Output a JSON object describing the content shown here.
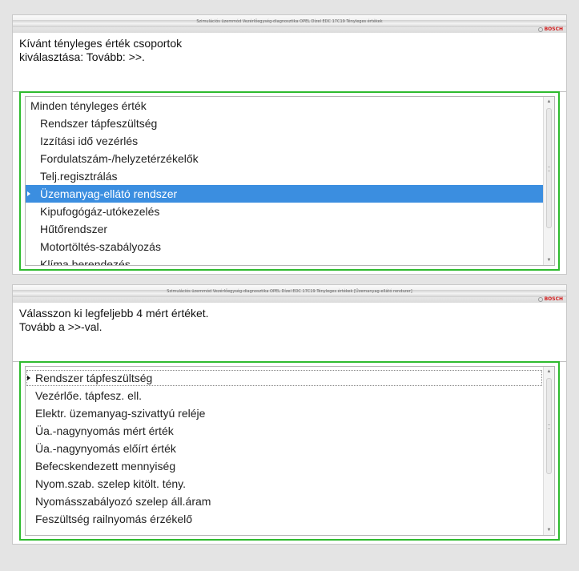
{
  "window1": {
    "title": "Szimulációs üzemmód Vezérlőegység-diagnosztika OPEL Dízel EDC 17C19 Tényleges értékek",
    "brand": "BOSCH",
    "prompt_line1": "Kívánt tényleges érték csoportok",
    "prompt_line2": "kiválasztása: Tovább: >>.",
    "items": [
      "Minden tényleges érték",
      "Rendszer tápfeszültség",
      "Izzítási idő vezérlés",
      "Fordulatszám-/helyzetérzékelők",
      "Telj.regisztrálás",
      "Üzemanyag-ellátó rendszer",
      "Kipufogógáz-utókezelés",
      "Hűtőrendszer",
      "Motortöltés-szabályozás",
      "Klíma berendezés"
    ],
    "selected_index": 5,
    "accent_color": "#3b8ee0",
    "frame_color": "#2fbb2f"
  },
  "window2": {
    "title": "Szimulációs üzemmód Vezérlőegység-diagnosztika OPEL Dízel EDC 17C19 Tényleges értékek [Üzemanyag-ellátó rendszer]",
    "brand": "BOSCH",
    "prompt_line1": "Válasszon ki legfeljebb 4 mért értéket.",
    "prompt_line2": "Tovább a >>-val.",
    "items": [
      "Rendszer tápfeszültség",
      "Vezérlőe. tápfesz. ell.",
      "Elektr. üzemanyag-szivattyú reléje",
      "Üa.-nagynyomás mért érték",
      "Üa.-nagynyomás előírt érték",
      "Befecskendezett mennyiség",
      "Nyom.szab. szelep kitölt. tény.",
      "Nyomásszabályozó szelep áll.áram",
      "Feszültség railnyomás érzékelő"
    ],
    "focused_index": 0,
    "frame_color": "#2fbb2f"
  },
  "icons": {
    "scroll_up": "scroll-up-arrow-icon",
    "scroll_down": "scroll-down-arrow-icon",
    "row_pointer": "row-pointer-icon",
    "brand_logo": "bosch-logo-icon"
  }
}
